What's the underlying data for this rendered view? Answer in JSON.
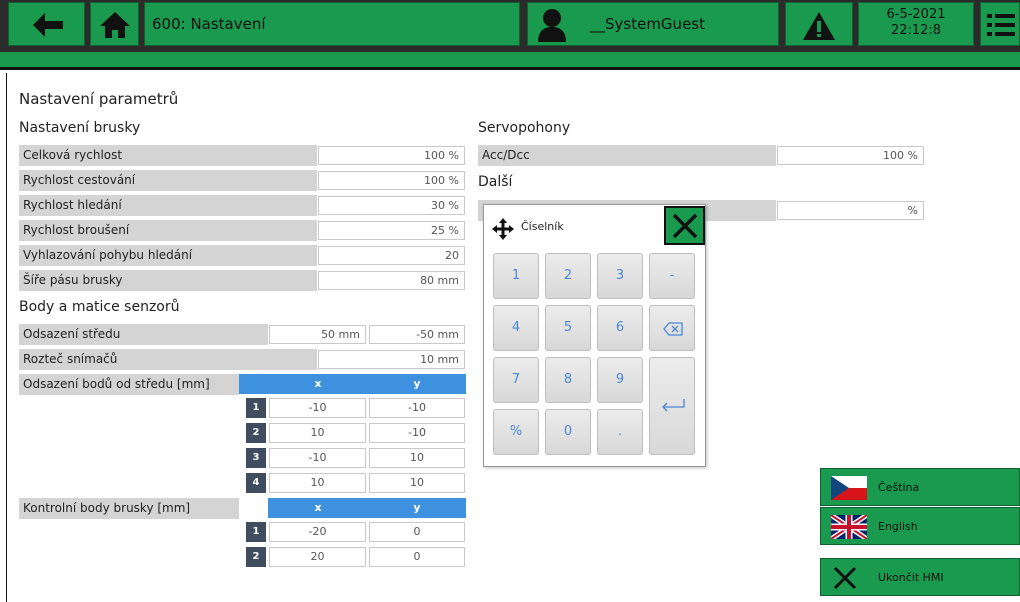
{
  "header": {
    "title": "600: Nastavení",
    "user": "__SystemGuest",
    "date": "6-5-2021",
    "time": "22:12:8"
  },
  "page_title": "Nastavení parametrů",
  "grinder": {
    "title": "Nastavení brusky",
    "rows": [
      {
        "label": "Celková rychlost",
        "value": "100 %"
      },
      {
        "label": "Rychlost cestování",
        "value": "100 %"
      },
      {
        "label": "Rychlost hledání",
        "value": "30 %"
      },
      {
        "label": "Rychlost broušení",
        "value": "25 %"
      },
      {
        "label": "Vyhlazování pohybu hledání",
        "value": "20"
      },
      {
        "label": "Šíře pásu brusky",
        "value": "80 mm"
      }
    ]
  },
  "sensors": {
    "title": "Body a matice senzorů",
    "center_offset": {
      "label": "Odsazení středu",
      "x": "50 mm",
      "y": "-50 mm"
    },
    "pitch": {
      "label": "Rozteč snímačů",
      "value": "10 mm"
    },
    "offset_table": {
      "label": "Odsazení bodů od středu [mm]",
      "col_x": "x",
      "col_y": "y",
      "rows": [
        {
          "n": "1",
          "x": "-10",
          "y": "-10"
        },
        {
          "n": "2",
          "x": "10",
          "y": "-10"
        },
        {
          "n": "3",
          "x": "-10",
          "y": "10"
        },
        {
          "n": "4",
          "x": "10",
          "y": "10"
        }
      ]
    },
    "control_table": {
      "label": "Kontrolní body brusky [mm]",
      "col_x": "x",
      "col_y": "y",
      "rows": [
        {
          "n": "1",
          "x": "-20",
          "y": "0"
        },
        {
          "n": "2",
          "x": "20",
          "y": "0"
        }
      ]
    }
  },
  "servo": {
    "title": "Servopohony",
    "acc": {
      "label": "Acc/Dcc",
      "value": "100 %"
    }
  },
  "other": {
    "title": "Další",
    "value": "%"
  },
  "numpad": {
    "title": "Číselník",
    "keys": [
      "1",
      "2",
      "3",
      "-",
      "4",
      "5",
      "6",
      "7",
      "8",
      "9",
      "%",
      "0",
      "."
    ]
  },
  "languages": {
    "czech": "Čeština",
    "english": "English",
    "exit": "Ukončit HMI"
  },
  "colors": {
    "green": "#199a4f",
    "blue_header": "#3e91de",
    "index_dark": "#3f4d5e",
    "row_gray": "#d4d4d4",
    "key_text": "#4a88d6"
  }
}
